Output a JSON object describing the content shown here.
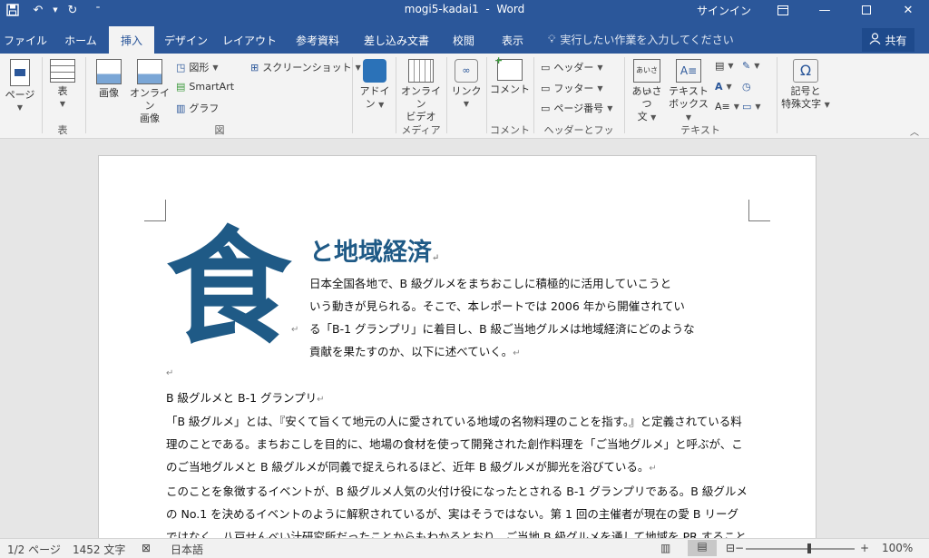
{
  "title": {
    "filename": "mogi5-kadai1",
    "separator": "-",
    "app": "Word",
    "signin": "サインイン"
  },
  "tabs": [
    "ファイル",
    "ホーム",
    "挿入",
    "デザイン",
    "レイアウト",
    "参考資料",
    "差し込み文書",
    "校閲",
    "表示"
  ],
  "active_tab": "挿入",
  "tellme": "実行したい作業を入力してください",
  "share": "共有",
  "ribbon": {
    "page": "ページ",
    "table": "表",
    "picture": "画像",
    "online_picture_1": "オンライン",
    "online_picture_2": "画像",
    "shapes": "図形",
    "smartart": "SmartArt",
    "chart": "グラフ",
    "screenshot": "スクリーンショット",
    "addins_1": "アドイ",
    "addins_2": "ン",
    "online_video_1": "オンライン",
    "online_video_2": "ビデオ",
    "link": "リンク",
    "comment": "コメント",
    "header": "ヘッダー",
    "footer": "フッター",
    "page_number": "ページ番号",
    "greeting_1": "あいさつ",
    "greeting_2": "文",
    "textbox_1": "テキスト",
    "textbox_2": "ボックス",
    "symbol_1": "記号と",
    "symbol_2": "特殊文字",
    "groups": {
      "table": "表",
      "illustrations": "図",
      "media": "メディア",
      "comment": "コメント",
      "header_footer": "ヘッダーとフッター",
      "text": "テキスト"
    }
  },
  "document": {
    "dropcap": "食",
    "heading": "と地域経済",
    "intro": [
      "日本全国各地で、B  級グルメをまちおこしに積極的に活用していこうと",
      "いう動きが見られる。そこで、本レポートでは  2006  年から開催されてい",
      "る「B-1 グランプリ」に着目し、B 級ご当地グルメは地域経済にどのような",
      "貢献を果たすのか、以下に述べていく。"
    ],
    "section_title": "B 級グルメと B-1 グランプリ",
    "body": [
      "「B  級グルメ」とは、『安くて旨くて地元の人に愛されている地域の名物料理のことを指す。』と定義されている料",
      "理のことである。まちおこしを目的に、地場の食材を使って開発された創作料理を「ご当地グルメ」と呼ぶが、こ",
      "のご当地グルメと B 級グルメが同義で捉えられるほど、近年 B 級グルメが脚光を浴びている。",
      "このことを象徴するイベントが、B  級グルメ人気の火付け役になったとされる  B-1  グランプリである。B 級グルメ",
      "の  No.1 を決めるイベントのように解釈されているが、実はそうではない。第 1 回の主催者が現在の愛 B リーグ",
      "ではなく、八戸せんべい汁研究所だったことからもわかるとおり、ご当地 B 級グルメを通して地域を PR すること"
    ]
  },
  "status": {
    "pages": "1/2 ページ",
    "words": "1452 文字",
    "language": "日本語",
    "zoom": "100%"
  }
}
